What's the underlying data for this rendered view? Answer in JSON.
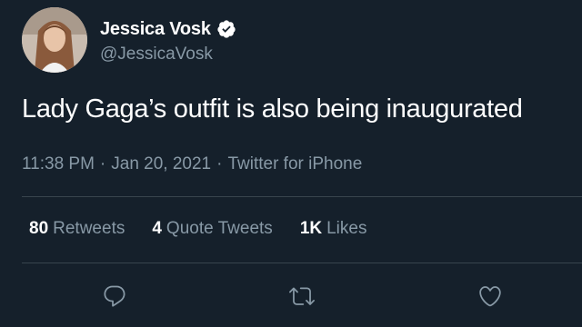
{
  "author": {
    "display_name": "Jessica Vosk",
    "handle": "@JessicaVosk",
    "verified": true
  },
  "tweet": {
    "text": "Lady Gaga’s outfit is also being inaugurated"
  },
  "meta": {
    "time": "11:38 PM",
    "separator": "·",
    "date": "Jan 20, 2021",
    "source": "Twitter for iPhone"
  },
  "stats": {
    "retweets": {
      "count": "80",
      "label": "Retweets"
    },
    "quote_tweets": {
      "count": "4",
      "label": "Quote Tweets"
    },
    "likes": {
      "count": "1K",
      "label": "Likes"
    }
  },
  "icons": {
    "reply": "reply-icon",
    "retweet": "retweet-icon",
    "like": "like-icon",
    "verified": "verified-badge-icon"
  },
  "colors": {
    "background": "#15202b",
    "primary_text": "#ffffff",
    "secondary_text": "#8899a6",
    "divider": "#38444d"
  }
}
